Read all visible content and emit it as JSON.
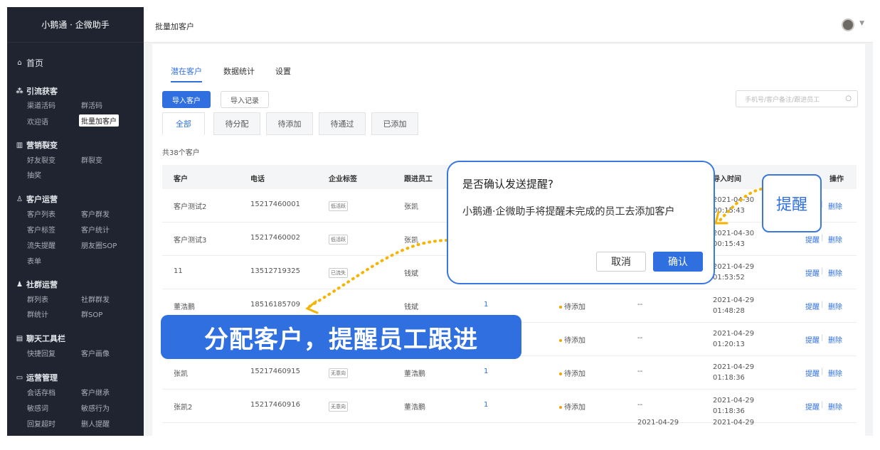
{
  "sidebar": {
    "brand": "小鹅通 · 企微助手",
    "home": "首页",
    "sections": [
      {
        "title": "引流获客",
        "items": [
          "渠道活码",
          "群活码",
          "欢迎语",
          "批量加客户"
        ]
      },
      {
        "title": "营销裂变",
        "items": [
          "好友裂变",
          "群裂变",
          "抽奖"
        ]
      },
      {
        "title": "客户运营",
        "items": [
          "客户列表",
          "客户群发",
          "客户标签",
          "客户统计",
          "流失提醒",
          "朋友圈SOP",
          "表单"
        ]
      },
      {
        "title": "社群运营",
        "items": [
          "群列表",
          "社群群发",
          "群统计",
          "群SOP"
        ]
      },
      {
        "title": "聊天工具栏",
        "items": [
          "快捷回复",
          "客户画像"
        ]
      },
      {
        "title": "运营管理",
        "items": [
          "会话存档",
          "客户继承",
          "敏感词",
          "敏感行为",
          "回复超时",
          "删人提醒"
        ]
      }
    ]
  },
  "topbar": {
    "page_title": "批量加客户"
  },
  "tabs": [
    "潜在客户",
    "数据统计",
    "设置"
  ],
  "toolbar": {
    "import_btn": "导入客户",
    "history_btn": "导入记录",
    "search_placeholder": "手机号/客户备注/跟进员工"
  },
  "filters": [
    "全部",
    "待分配",
    "待添加",
    "待通过",
    "已添加"
  ],
  "total": "共38个客户",
  "columns": {
    "customer": "客户",
    "phone": "电话",
    "tag": "企业标签",
    "staff": "跟进员工",
    "time": "导入时间",
    "action": "操作"
  },
  "rows": [
    {
      "customer": "客户测试2",
      "phone": "15217460001",
      "tag": "低活跃",
      "staff": "张凯",
      "count": "",
      "status": "",
      "extra": "",
      "date": "2021-04-30",
      "clock": "00:15:43"
    },
    {
      "customer": "客户测试3",
      "phone": "15217460002",
      "tag": "低活跃",
      "staff": "张凯",
      "count": "",
      "status": "",
      "extra": "",
      "date": "2021-04-30",
      "clock": "00:15:43"
    },
    {
      "customer": "11",
      "phone": "13512719325",
      "tag": "已流失",
      "staff": "钱斌",
      "count": "",
      "status": "",
      "extra": "",
      "date": "2021-04-29",
      "clock": "01:53:52"
    },
    {
      "customer": "董浩鹏",
      "phone": "18516185709",
      "tag": "",
      "staff": "钱斌",
      "count": "1",
      "status": "待添加",
      "extra": "--",
      "date": "2021-04-29",
      "clock": "01:48:28"
    },
    {
      "customer": "",
      "phone": "",
      "tag": "",
      "staff": "",
      "count": "",
      "status": "待添加",
      "extra": "--",
      "date": "2021-04-29",
      "clock": "01:20:13"
    },
    {
      "customer": "张凯",
      "phone": "15217460915",
      "tag": "无意向",
      "staff": "董浩鹏",
      "count": "1",
      "status": "待添加",
      "extra": "--",
      "date": "2021-04-29",
      "clock": "01:18:36"
    },
    {
      "customer": "张凯2",
      "phone": "15217460916",
      "tag": "无意向",
      "staff": "董浩鹏",
      "count": "1",
      "status": "待添加",
      "extra": "--",
      "date": "2021-04-29",
      "clock": "01:18:36"
    },
    {
      "customer": "",
      "phone": "",
      "tag": "",
      "staff": "",
      "count": "",
      "status": "",
      "extra": "2021-04-29",
      "date": "2021-04-29",
      "clock": ""
    }
  ],
  "actions": {
    "remind": "提醒",
    "delete": "删除"
  },
  "dialog": {
    "title": "是否确认发送提醒?",
    "content": "小鹅通·企微助手将提醒未完成的员工去添加客户",
    "cancel": "取消",
    "confirm": "确认"
  },
  "callout": "提醒",
  "banner": "分配客户，提醒员工跟进",
  "colors": {
    "primary": "#2f6fe0",
    "sidebar": "#1f2430",
    "annotation": "#f5b400"
  }
}
